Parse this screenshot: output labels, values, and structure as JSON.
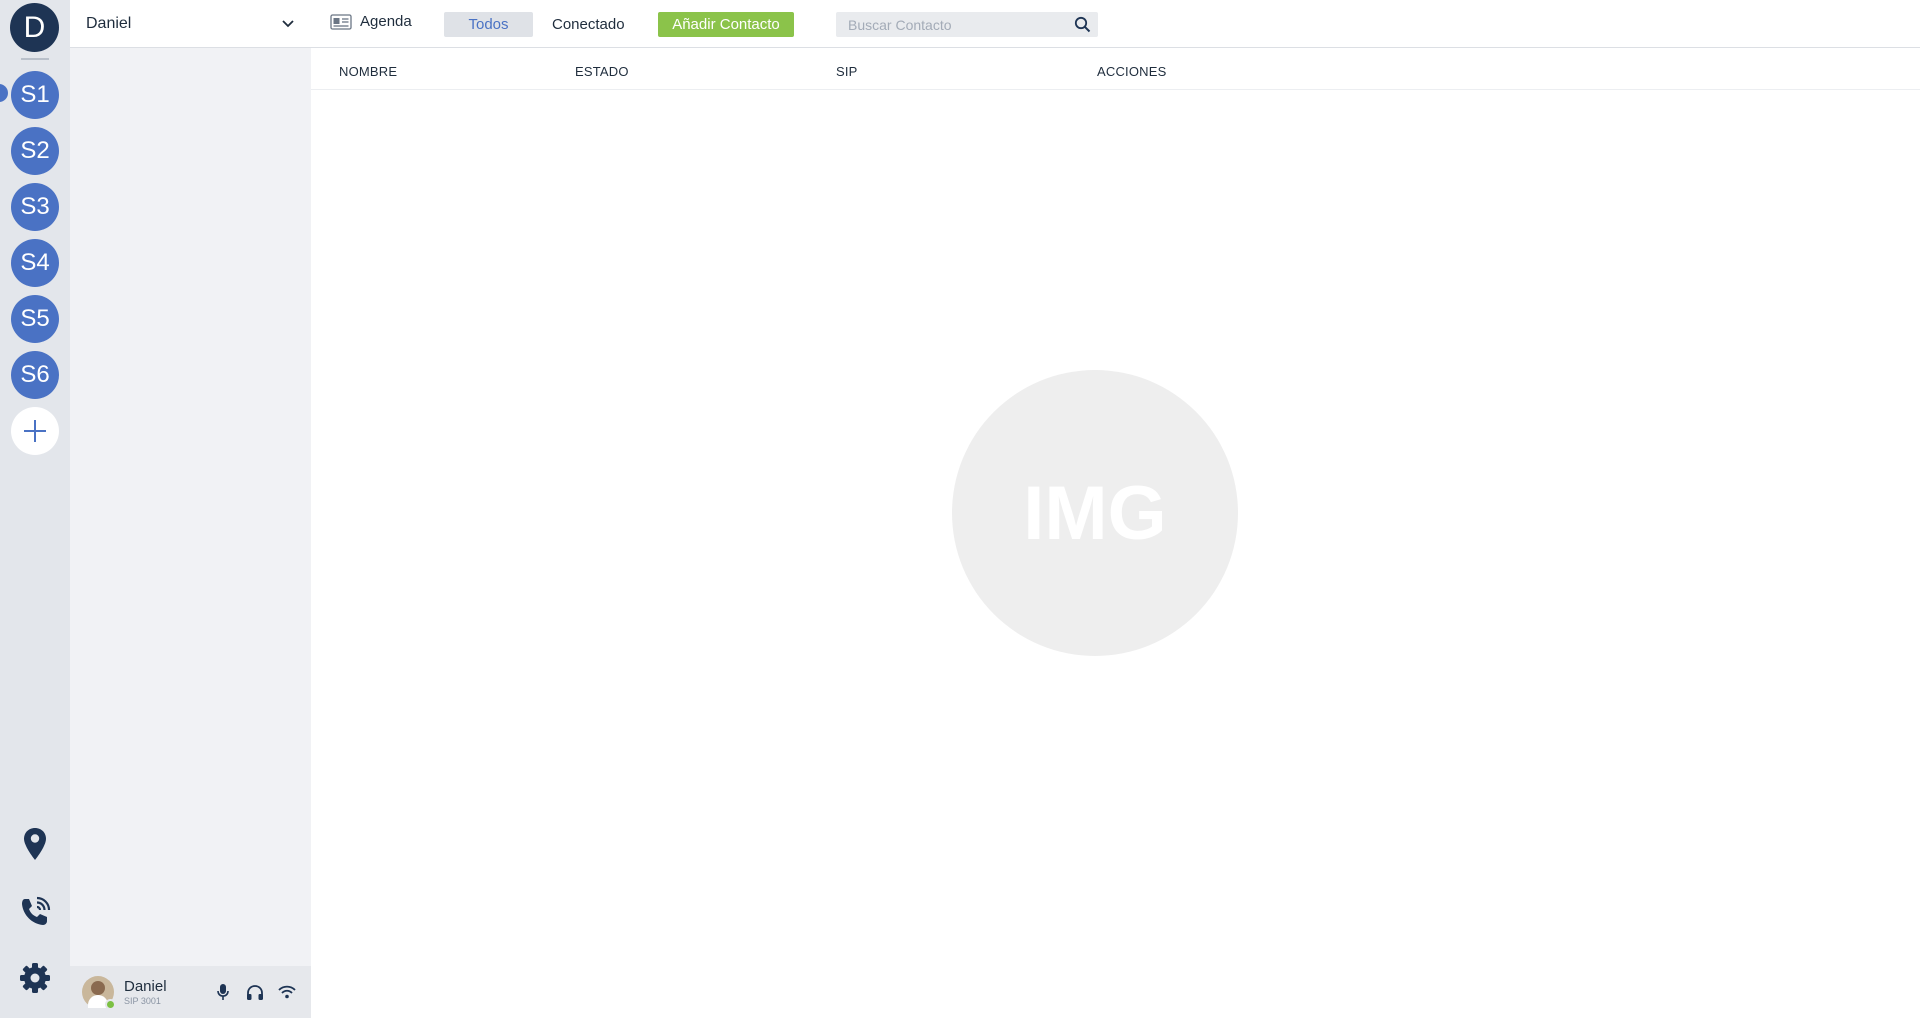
{
  "rail": {
    "home_letter": "D",
    "servers": [
      {
        "label": "S1",
        "active": true
      },
      {
        "label": "S2"
      },
      {
        "label": "S3"
      },
      {
        "label": "S4"
      },
      {
        "label": "S5"
      },
      {
        "label": "S6"
      }
    ],
    "add_icon": "plus-icon",
    "bottom_icons": [
      "map-pin-icon",
      "phone-calling-icon",
      "gear-icon"
    ]
  },
  "sidebar": {
    "server_name": "Daniel",
    "dropdown_icon": "chevron-down-icon",
    "footer": {
      "user_name": "Daniel",
      "sip": "SIP 3001",
      "status_color": "#7cc043",
      "icons": [
        "microphone-icon",
        "headphones-icon",
        "wifi-icon"
      ]
    }
  },
  "toolbar": {
    "agenda_label": "Agenda",
    "tab_todos": "Todos",
    "tab_conectado": "Conectado",
    "add_contact_label": "Añadir Contacto",
    "search_placeholder": "Buscar Contacto"
  },
  "table": {
    "columns": [
      "NOMBRE",
      "ESTADO",
      "SIP",
      "ACCIONES"
    ]
  },
  "empty_state": {
    "image_text": "IMG"
  },
  "colors": {
    "accent": "#4a72c4",
    "add_button": "#8bc34a",
    "home": "#1e3454"
  }
}
